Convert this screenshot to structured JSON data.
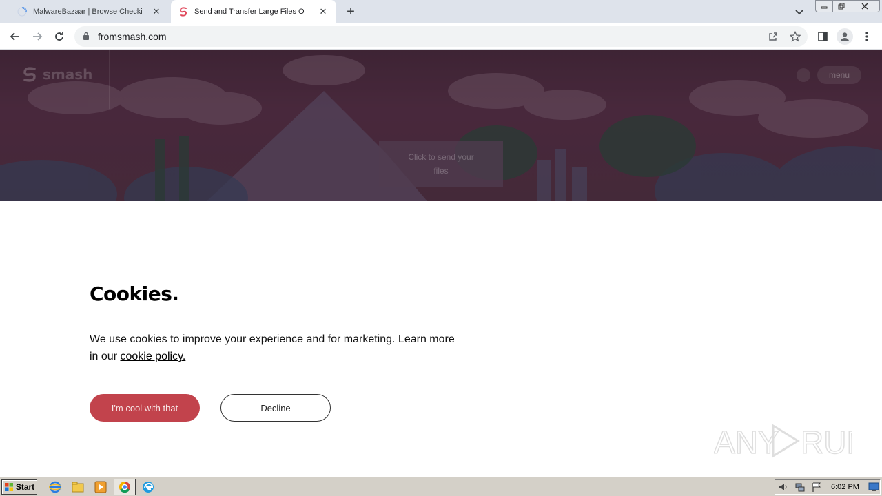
{
  "browser": {
    "tabs": [
      {
        "title": "MalwareBazaar | Browse Checking y",
        "active": false
      },
      {
        "title": "Send and Transfer Large Files Online",
        "active": true
      }
    ],
    "url": "fromsmash.com"
  },
  "hero": {
    "logo_text": "smash",
    "menu_label": "menu",
    "send_label": "Click to send your files"
  },
  "cookies": {
    "title": "Cookies.",
    "text_before": "We use cookies to improve your experience and for marketing. Learn more in our ",
    "policy_link": "cookie policy.",
    "accept_label": "I'm cool with that",
    "decline_label": "Decline"
  },
  "colors": {
    "accept": "#c2434c",
    "hero": "#4a2838"
  },
  "taskbar": {
    "start_label": "Start",
    "clock": "6:02 PM"
  },
  "watermark": "ANY RUN"
}
